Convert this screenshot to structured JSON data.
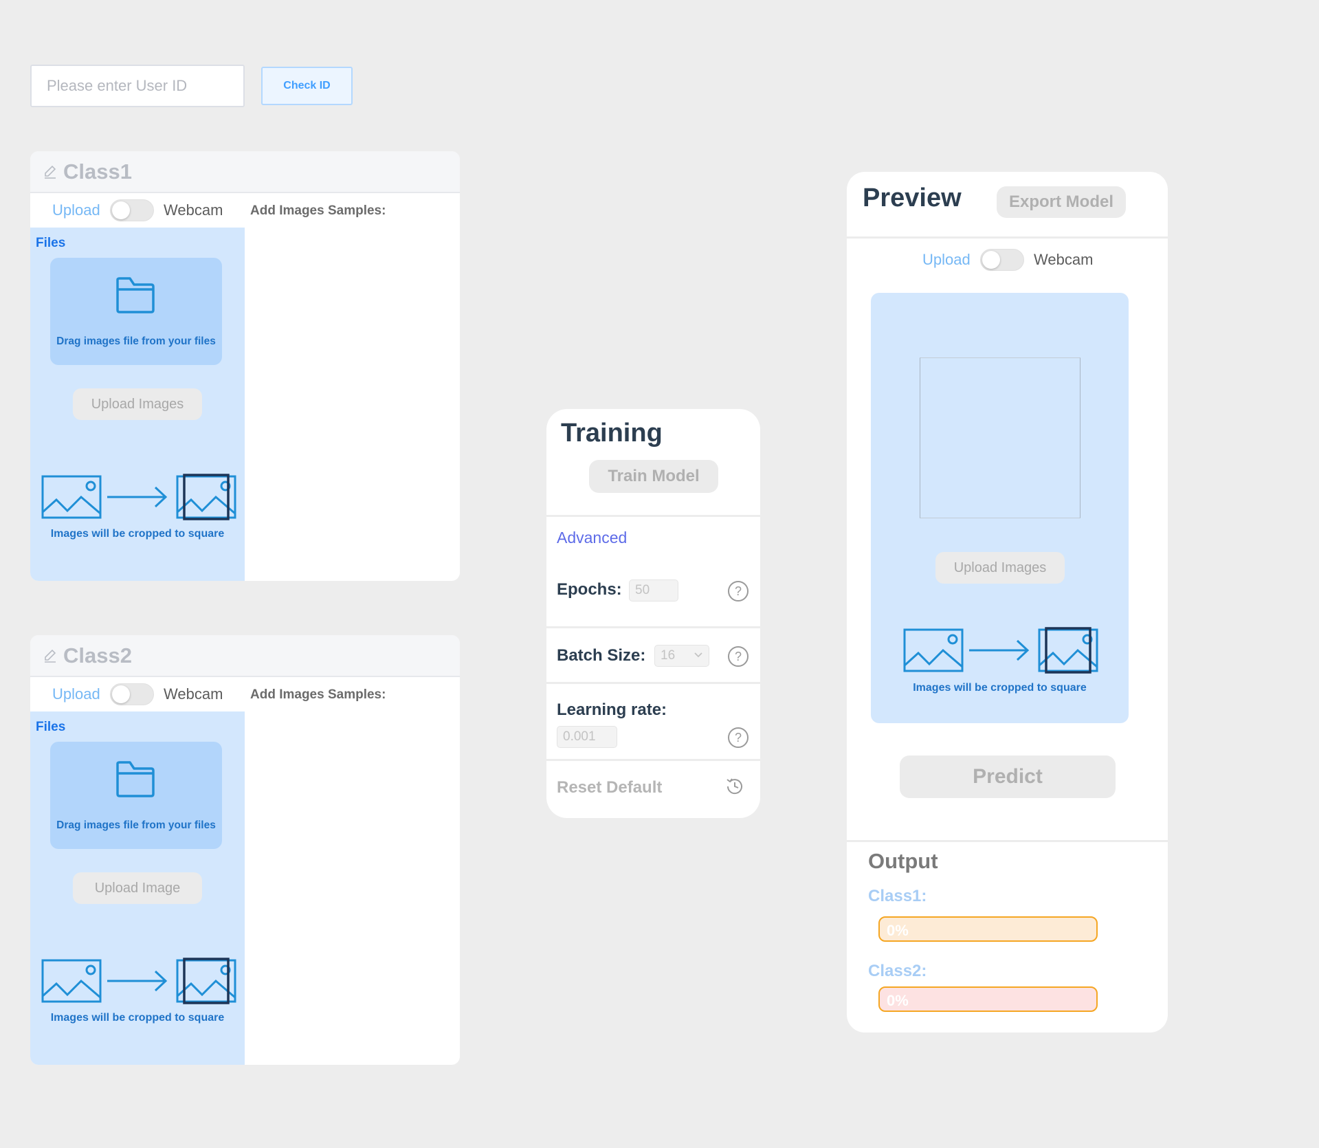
{
  "top": {
    "user_id_placeholder": "Please enter User ID",
    "check_button": "Check ID"
  },
  "classes": [
    {
      "title": "Class1",
      "mode_upload": "Upload",
      "mode_webcam": "Webcam",
      "samples_label": "Add Images Samples:",
      "files_label": "Files",
      "drop_text": "Drag images file from your files",
      "upload_button": "Upload Images",
      "crop_text": "Images will be cropped to square"
    },
    {
      "title": "Class2",
      "mode_upload": "Upload",
      "mode_webcam": "Webcam",
      "samples_label": "Add Images Samples:",
      "files_label": "Files",
      "drop_text": "Drag images file from your files",
      "upload_button": "Upload Image",
      "crop_text": "Images will be cropped to square"
    }
  ],
  "training": {
    "title": "Training",
    "train_button": "Train Model",
    "advanced": "Advanced",
    "epochs_label": "Epochs:",
    "epochs_value": "50",
    "batch_label": "Batch Size:",
    "batch_value": "16",
    "lr_label": "Learning rate:",
    "lr_value": "0.001",
    "reset_label": "Reset Default"
  },
  "preview": {
    "title": "Preview",
    "export_button": "Export Model",
    "mode_upload": "Upload",
    "mode_webcam": "Webcam",
    "upload_button": "Upload Images",
    "crop_text": "Images will be cropped to square",
    "predict_button": "Predict",
    "output_title": "Output",
    "outputs": [
      {
        "label": "Class1:",
        "percent": "0%",
        "fill_color": "#fdebd6"
      },
      {
        "label": "Class2:",
        "percent": "0%",
        "fill_color": "#fde2e2"
      }
    ]
  },
  "colors": {
    "background": "#ededed",
    "accent_blue": "#1a73e8",
    "panel_blue": "#d3e7fd",
    "icon_blue": "#1f8fd6",
    "bar_border": "#f5a623"
  },
  "icons": [
    "pencil-icon",
    "folder-icon",
    "image-icon",
    "arrow-right-icon",
    "cropped-image-icon",
    "help-icon",
    "chevron-down-icon",
    "history-icon"
  ]
}
